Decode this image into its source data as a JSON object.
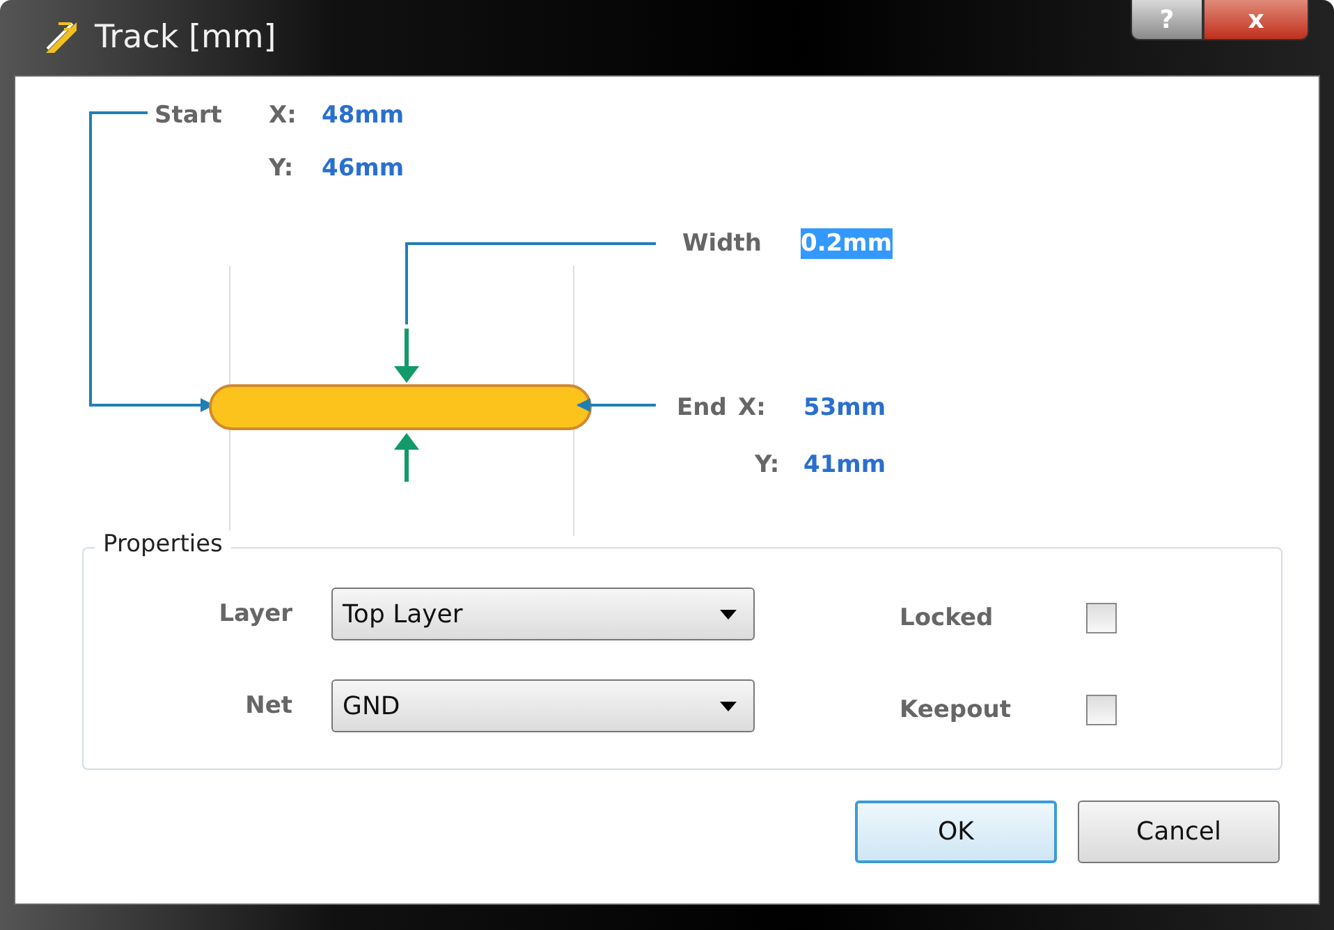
{
  "window": {
    "title": "Track [mm]",
    "help_button": "?",
    "close_button": "x"
  },
  "start": {
    "label": "Start",
    "x_label": "X:",
    "x": "48mm",
    "y_label": "Y:",
    "y": "46mm"
  },
  "width": {
    "label": "Width",
    "value": "0.2mm",
    "selected": true
  },
  "end": {
    "label": "End",
    "x_label": "X:",
    "x": "53mm",
    "y_label": "Y:",
    "y": "41mm"
  },
  "properties": {
    "title": "Properties",
    "fields": [
      {
        "label": "Layer",
        "value": "Top Layer"
      },
      {
        "label": "Net",
        "value": "GND"
      }
    ],
    "checks": [
      {
        "label": "Locked",
        "checked": false
      },
      {
        "label": "Keepout",
        "checked": false
      }
    ]
  },
  "buttons": [
    {
      "label": "OK",
      "default": true
    },
    {
      "label": "Cancel",
      "default": false
    }
  ]
}
